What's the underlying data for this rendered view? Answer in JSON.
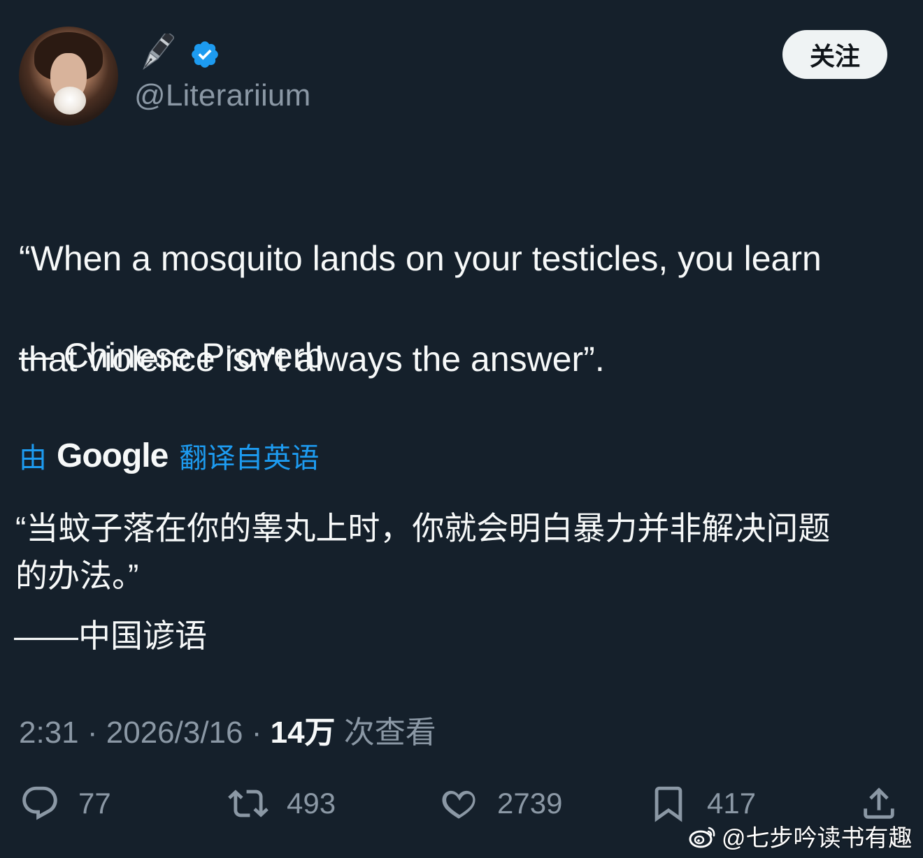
{
  "author": {
    "display_emoji": "pen-nib-emoji",
    "handle": "@Literariium",
    "verified": true
  },
  "follow_button": {
    "label": "关注"
  },
  "tweet": {
    "text_lines": [
      "“When a mosquito lands on your testicles, you learn",
      "that violence isn't always the answer”."
    ],
    "attribution": "— Chinese Proverb"
  },
  "translation": {
    "by_label": "由",
    "provider": "Google",
    "from_label": "翻译自英语",
    "text_lines": [
      "“当蚊子落在你的睾丸上时，你就会明白暴力并非解决问题",
      "的办法。”"
    ],
    "attribution": "——中国谚语"
  },
  "meta": {
    "time": "2:31",
    "sep1": " · ",
    "date": "2026/3/16",
    "sep2": " · ",
    "views_count": "14万",
    "views_label": " 次查看"
  },
  "actions": {
    "replies": "77",
    "retweets": "493",
    "likes": "2739",
    "bookmarks": "417"
  },
  "watermark": {
    "text": "@七步吟读书有趣"
  },
  "colors": {
    "background": "#15202b",
    "text": "#f7f9f9",
    "secondary": "#8b98a5",
    "accent": "#1d9bf0"
  }
}
